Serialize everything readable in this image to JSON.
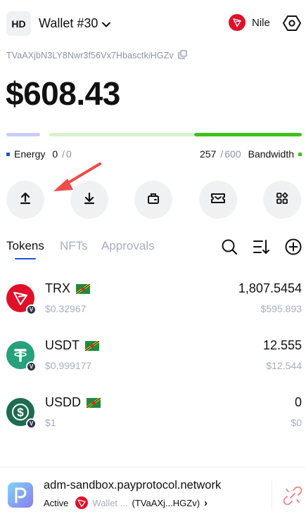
{
  "header": {
    "badge": "HD",
    "wallet_name": "Wallet #30",
    "network_name": "Nile"
  },
  "account": {
    "address": "TVaAXjbN3LY8Nwr3f56Vx7HbasctkiHGZv",
    "balance": "$608.43"
  },
  "resources": {
    "energy_label": "Energy",
    "energy_used": "0",
    "energy_sep": "/",
    "energy_total": "0",
    "bandwidth_label": "Bandwidth",
    "bandwidth_used": "257",
    "bandwidth_sep": "/",
    "bandwidth_total": "600",
    "bandwidth_fraction_used": 0.428,
    "energy_color": "#1b54d8",
    "bandwidth_color": "#3fc11a"
  },
  "actions": [
    {
      "icon": "send-icon"
    },
    {
      "icon": "receive-icon"
    },
    {
      "icon": "stake-icon"
    },
    {
      "icon": "voucher-icon"
    },
    {
      "icon": "apps-icon"
    }
  ],
  "tabs": {
    "tokens": "Tokens",
    "nfts": "NFTs",
    "approvals": "Approvals"
  },
  "tokens": [
    {
      "symbol": "TRX",
      "price": "$0.32967",
      "amount": "1,807.5454",
      "value": "$595.893",
      "color": "#e0102a"
    },
    {
      "symbol": "USDT",
      "price": "$0.999177",
      "amount": "12.555",
      "value": "$12.544",
      "color": "#26a17b"
    },
    {
      "symbol": "USDD",
      "price": "$1",
      "amount": "0",
      "value": "$0",
      "color": "#1e6b52"
    }
  ],
  "dapp": {
    "url": "adm-sandbox.payprotocol.network",
    "status": "Active",
    "wallet": "Wallet ...",
    "address_short": "(TVaAXj...HGZv)",
    "chevron": "›"
  },
  "colors": {
    "accent": "#1b54d8",
    "tron_red": "#e0102a",
    "muted": "#a7aec0",
    "annotation_arrow": "#f04b4b"
  }
}
